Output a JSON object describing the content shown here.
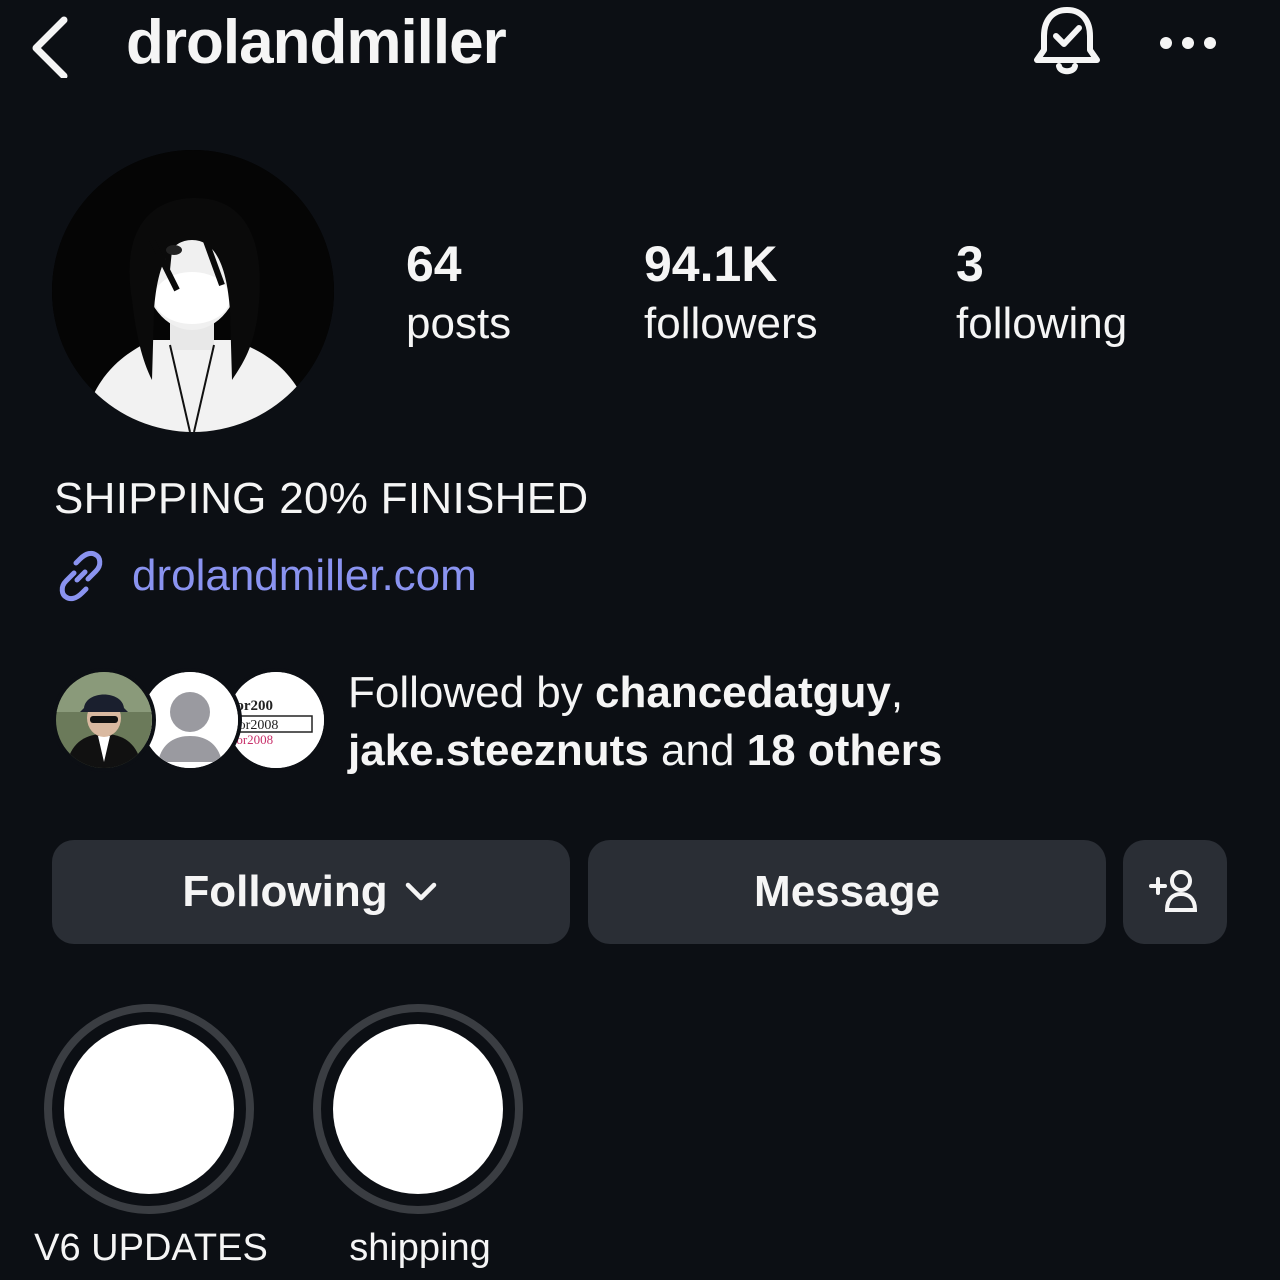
{
  "header": {
    "username": "drolandmiller",
    "back_icon": "chevron-left-icon",
    "bell_icon": "bell-check-icon",
    "more_icon": "more-horizontal-icon"
  },
  "stats": {
    "posts": {
      "value": "64",
      "label": "posts"
    },
    "followers": {
      "value": "94.1K",
      "label": "followers"
    },
    "following": {
      "value": "3",
      "label": "following"
    }
  },
  "bio": {
    "text": "SHIPPING 20% FINISHED",
    "link": "drolandmiller.com",
    "link_icon": "link-icon",
    "link_color": "#8a93f0"
  },
  "followed_by": {
    "prefix": "Followed by ",
    "user1": "chancedatguy",
    "sep": ",",
    "user2": "jake.steeznuts",
    "middle": " and ",
    "others": "18 others"
  },
  "actions": {
    "following_label": "Following",
    "message_label": "Message",
    "add_user_icon": "add-user-icon",
    "dropdown_icon": "chevron-down-icon"
  },
  "highlights": [
    {
      "label": "V6 UPDATES"
    },
    {
      "label": "shipping"
    }
  ],
  "colors": {
    "background": "#0c0f14",
    "button_bg": "#2a2e35",
    "ring": "#3a3d42",
    "text": "#f5f5f5"
  }
}
